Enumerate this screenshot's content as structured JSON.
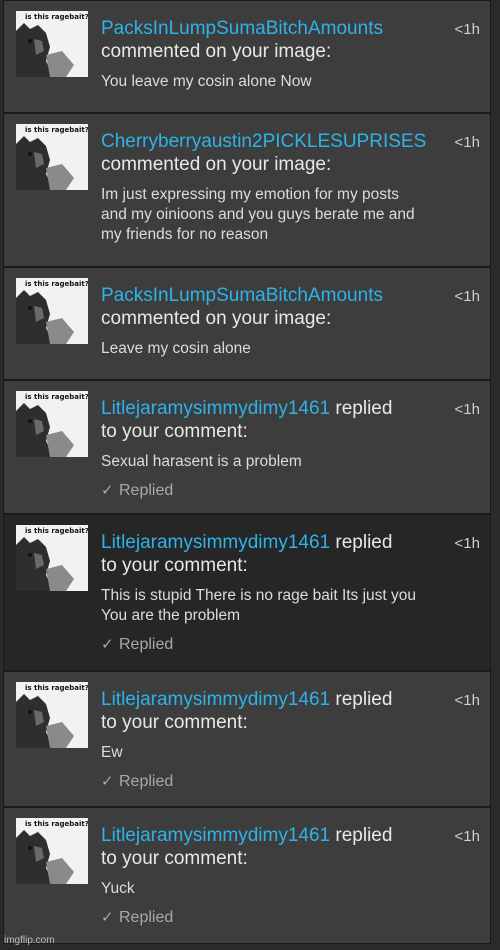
{
  "thumbnail_caption": "is this ragebait?",
  "watermark": "imgflip.com",
  "notifications": [
    {
      "user": "PacksInLumpSumaBitchAmounts",
      "action": "",
      "action_line2": "commented on your image:",
      "message": "You leave my cosin alone Now",
      "time": "<1h",
      "status": "",
      "dark": false
    },
    {
      "user": "Cherryberryaustin2PICKLESUPRISES",
      "action": "",
      "action_line2": "commented on your image:",
      "message": "Im just expressing my emotion for my posts and my oinioons and you guys berate me and my friends for no reason",
      "time": "<1h",
      "status": "",
      "dark": false
    },
    {
      "user": "PacksInLumpSumaBitchAmounts",
      "action": "",
      "action_line2": "commented on your image:",
      "message": "Leave my cosin alone",
      "time": "<1h",
      "status": "",
      "dark": false
    },
    {
      "user": "Litlejaramysimmydimy1461",
      "action": " replied",
      "action_line2": "to your comment:",
      "message": "Sexual harasent is a problem",
      "time": "<1h",
      "status": "Replied",
      "dark": false
    },
    {
      "user": "Litlejaramysimmydimy1461",
      "action": " replied",
      "action_line2": "to your comment:",
      "message": "This is stupid There is no rage bait Its just you You are the problem",
      "time": "<1h",
      "status": "Replied",
      "dark": true
    },
    {
      "user": "Litlejaramysimmydimy1461",
      "action": " replied",
      "action_line2": "to your comment:",
      "message": "Ew",
      "time": "<1h",
      "status": "Replied",
      "dark": false
    },
    {
      "user": "Litlejaramysimmydimy1461",
      "action": " replied",
      "action_line2": "to your comment:",
      "message": "Yuck",
      "time": "<1h",
      "status": "Replied",
      "dark": false
    }
  ]
}
